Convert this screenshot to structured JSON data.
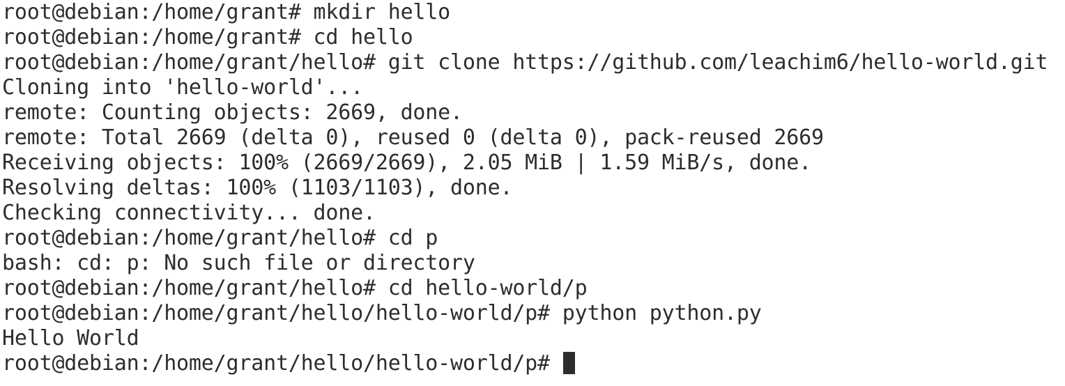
{
  "terminal": {
    "lines": [
      "root@debian:/home/grant# mkdir hello",
      "root@debian:/home/grant# cd hello",
      "root@debian:/home/grant/hello# git clone https://github.com/leachim6/hello-world.git",
      "Cloning into 'hello-world'...",
      "remote: Counting objects: 2669, done.",
      "remote: Total 2669 (delta 0), reused 0 (delta 0), pack-reused 2669",
      "Receiving objects: 100% (2669/2669), 2.05 MiB | 1.59 MiB/s, done.",
      "Resolving deltas: 100% (1103/1103), done.",
      "Checking connectivity... done.",
      "root@debian:/home/grant/hello# cd p",
      "bash: cd: p: No such file or directory",
      "root@debian:/home/grant/hello# cd hello-world/p",
      "root@debian:/home/grant/hello/hello-world/p# python python.py",
      "Hello World"
    ],
    "current_prompt": "root@debian:/home/grant/hello/hello-world/p# "
  },
  "colors": {
    "background": "#ffffff",
    "foreground": "#2d2d2d"
  }
}
